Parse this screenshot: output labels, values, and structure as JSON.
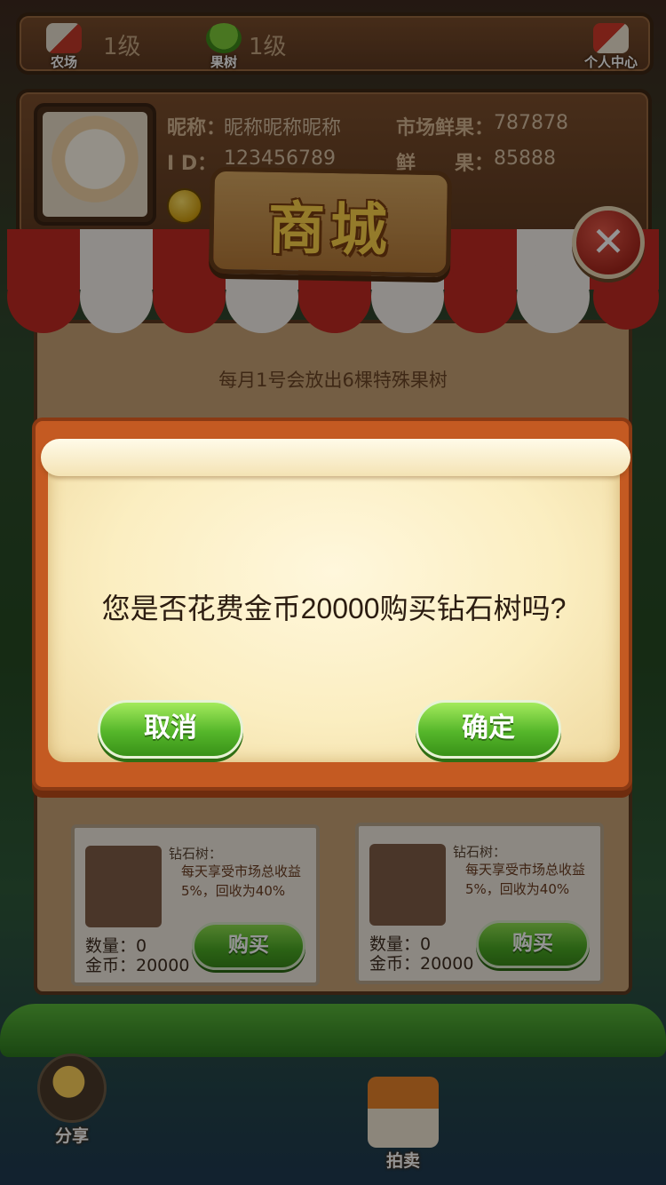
{
  "topbar": {
    "farm_label": "农场",
    "farm_level": "1级",
    "orchard_label": "果树",
    "orchard_level": "1级",
    "personal_center_label": "个人中心"
  },
  "profile": {
    "nickname_label": "昵称：",
    "nickname_value": "昵称昵称昵称",
    "id_label": "I D：",
    "id_value": "123456789",
    "market_fruit_label": "市场鲜果：",
    "market_fruit_value": "787878",
    "fruit_label": "鲜　　果：",
    "fruit_value": "85888"
  },
  "shop": {
    "title": "商城",
    "close_symbol": "✕",
    "notice": "每月1号会放出6棵特殊果树",
    "cards": [
      {
        "name": "钻石树：",
        "desc": "每天享受市场总收益5%，回收为40%",
        "quantity": "数量：0",
        "price": "金币：20000",
        "buy_label": "购买"
      },
      {
        "name": "钻石树：",
        "desc": "每天享受市场总收益5%，回收为40%",
        "quantity": "数量：0",
        "price": "金币：20000",
        "buy_label": "购买"
      }
    ]
  },
  "dialog": {
    "message": "您是否花费金币20000购买钻石树吗?",
    "cancel_label": "取消",
    "confirm_label": "确定"
  },
  "bottom_nav": {
    "share_label": "分享",
    "auction_label": "拍卖"
  },
  "colors": {
    "wood_dark": "#5d3a22",
    "button_green": "#4aa824",
    "dialog_orange": "#c45a22",
    "parchment": "#fbeec1",
    "close_red": "#a8271d",
    "sign_gold": "#ffd54a"
  }
}
